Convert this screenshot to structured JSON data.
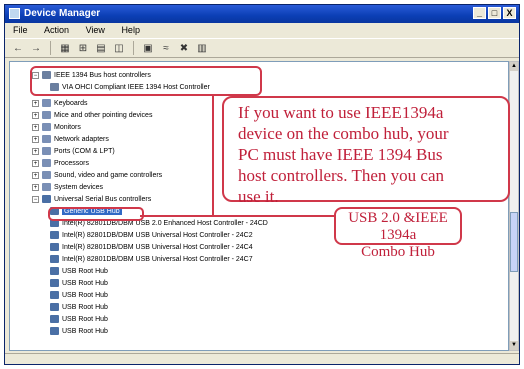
{
  "window": {
    "title": "Device Manager",
    "controls": {
      "minimize": "_",
      "maximize": "□",
      "close": "X"
    }
  },
  "menu": {
    "file": "File",
    "action": "Action",
    "view": "View",
    "help": "Help"
  },
  "toolbar": {
    "icons": [
      "back-icon",
      "forward-icon",
      "properties-icon",
      "refresh-icon",
      "print-icon",
      "help-icon",
      "scan-icon",
      "update-icon",
      "uninstall-icon",
      "disable-icon"
    ]
  },
  "tree": {
    "ieee_group": "IEEE 1394 Bus host controllers",
    "ieee_controller": "VIA OHCI Compliant IEEE 1394 Host Controller",
    "keyboards": "Keyboards",
    "mice": "Mice and other pointing devices",
    "monitors": "Monitors",
    "network": "Network adapters",
    "ports": "Ports (COM & LPT)",
    "processors": "Processors",
    "sound": "Sound, video and game controllers",
    "system": "System devices",
    "usb_group": "Universal Serial Bus controllers",
    "usb_items": [
      "Generic USB Hub",
      "Intel(R) 82801DB/DBM USB 2.0 Enhanced Host Controller - 24CD",
      "Intel(R) 82801DB/DBM USB Universal Host Controller - 24C2",
      "Intel(R) 82801DB/DBM USB Universal Host Controller - 24C4",
      "Intel(R) 82801DB/DBM USB Universal Host Controller - 24C7",
      "USB Root Hub",
      "USB Root Hub",
      "USB Root Hub",
      "USB Root Hub",
      "USB Root Hub",
      "USB Root Hub"
    ]
  },
  "annotations": {
    "note_lines": [
      "If you want to use IEEE1394a",
      "device on the combo hub, your",
      "PC must have IEEE 1394 Bus",
      "host controllers. Then you can",
      "use it."
    ],
    "combo_lines": [
      "USB 2.0 &IEEE 1394a",
      "Combo Hub"
    ]
  },
  "colors": {
    "annotation_red": "#d0384a",
    "title_blue": "#0b3fb5",
    "selection_blue": "#316ac5"
  }
}
